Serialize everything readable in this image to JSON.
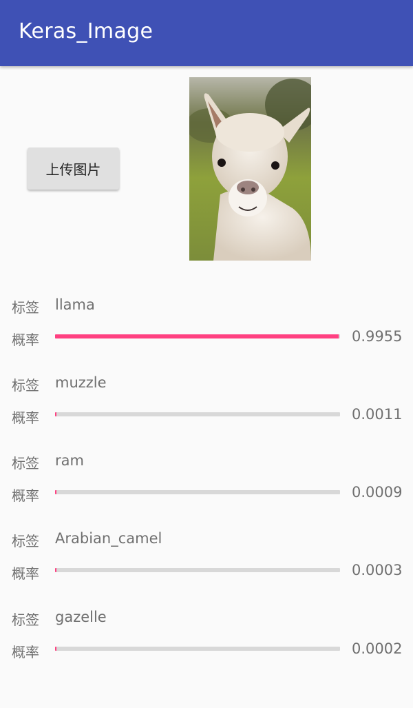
{
  "app_bar": {
    "title": "Keras_Image",
    "color": "#3f51b5"
  },
  "upload_button": {
    "label": "上传图片"
  },
  "accent_color": "#ff4081",
  "results": [
    {
      "label_key": "标签",
      "label": "llama",
      "prob_key": "概率",
      "probability": "0.9955",
      "fill": 0.9955
    },
    {
      "label_key": "标签",
      "label": "muzzle",
      "prob_key": "概率",
      "probability": "0.0011",
      "fill": 0.0011
    },
    {
      "label_key": "标签",
      "label": "ram",
      "prob_key": "概率",
      "probability": "0.0009",
      "fill": 0.0009
    },
    {
      "label_key": "标签",
      "label": "Arabian_camel",
      "prob_key": "概率",
      "probability": "0.0003",
      "fill": 0.0003
    },
    {
      "label_key": "标签",
      "label": "gazelle",
      "prob_key": "概率",
      "probability": "0.0002",
      "fill": 0.0002
    }
  ]
}
